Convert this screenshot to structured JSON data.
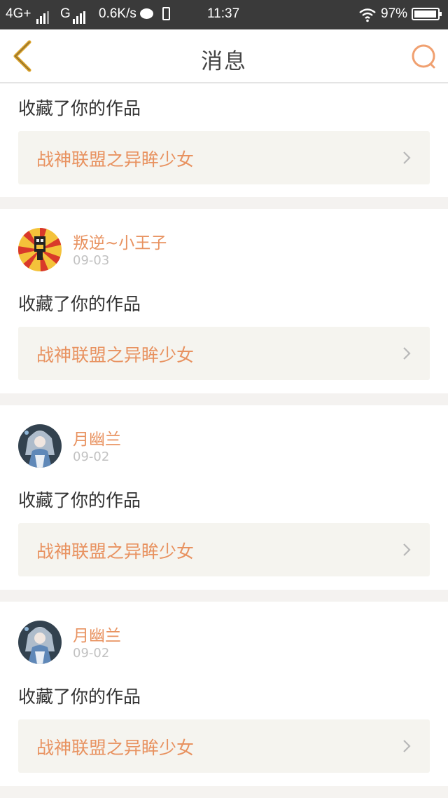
{
  "status_bar": {
    "network": "4G+",
    "network2": "G",
    "speed": "0.6K/s",
    "time": "11:37",
    "battery": "97%",
    "battery_level": 0.97
  },
  "header": {
    "title": "消息",
    "back_icon": "chevron-left-icon",
    "search_icon": "search-icon"
  },
  "colors": {
    "accent": "#e89260",
    "accent_icon": "#d9a12a",
    "box_bg": "#f5f4ef",
    "divider": "#f4f2f0"
  },
  "messages": [
    {
      "action": "收藏了你的作品",
      "work_title": "战神联盟之异眸少女"
    },
    {
      "user": "叛逆~小王子",
      "date": "09-03",
      "avatar": "pixel-robot-avatar",
      "action": "收藏了你的作品",
      "work_title": "战神联盟之异眸少女"
    },
    {
      "user": "月幽兰",
      "date": "09-02",
      "avatar": "anime-girl-avatar",
      "action": "收藏了你的作品",
      "work_title": "战神联盟之异眸少女"
    },
    {
      "user": "月幽兰",
      "date": "09-02",
      "avatar": "anime-girl-avatar",
      "action": "收藏了你的作品",
      "work_title": "战神联盟之异眸少女"
    }
  ]
}
